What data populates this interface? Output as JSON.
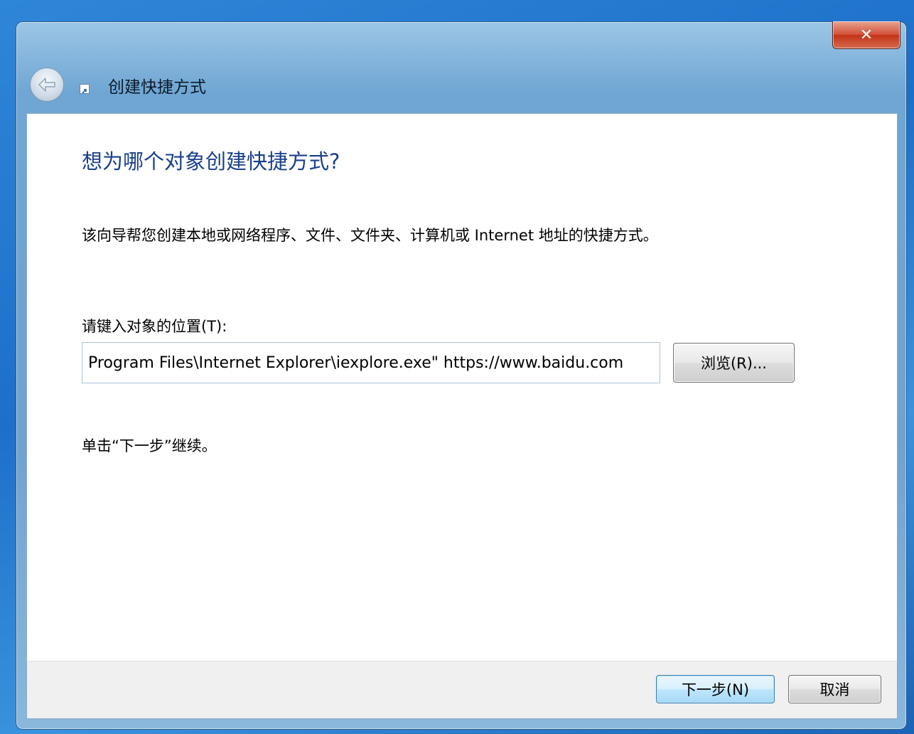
{
  "window": {
    "title": "创建快捷方式",
    "close_glyph": "✕"
  },
  "content": {
    "heading": "想为哪个对象创建快捷方式?",
    "description": "该向导帮您创建本地或网络程序、文件、文件夹、计算机或 Internet 地址的快捷方式。",
    "location_label": "请键入对象的位置(T):",
    "location_value": "Program Files\\Internet Explorer\\iexplore.exe\" https://www.baidu.com",
    "browse_label": "浏览(R)...",
    "continue_text": "单击“下一步”继续。"
  },
  "footer": {
    "next_label": "下一步(N)",
    "cancel_label": "取消"
  },
  "colors": {
    "heading": "#1a3f8c",
    "close_button": "#c43417"
  }
}
